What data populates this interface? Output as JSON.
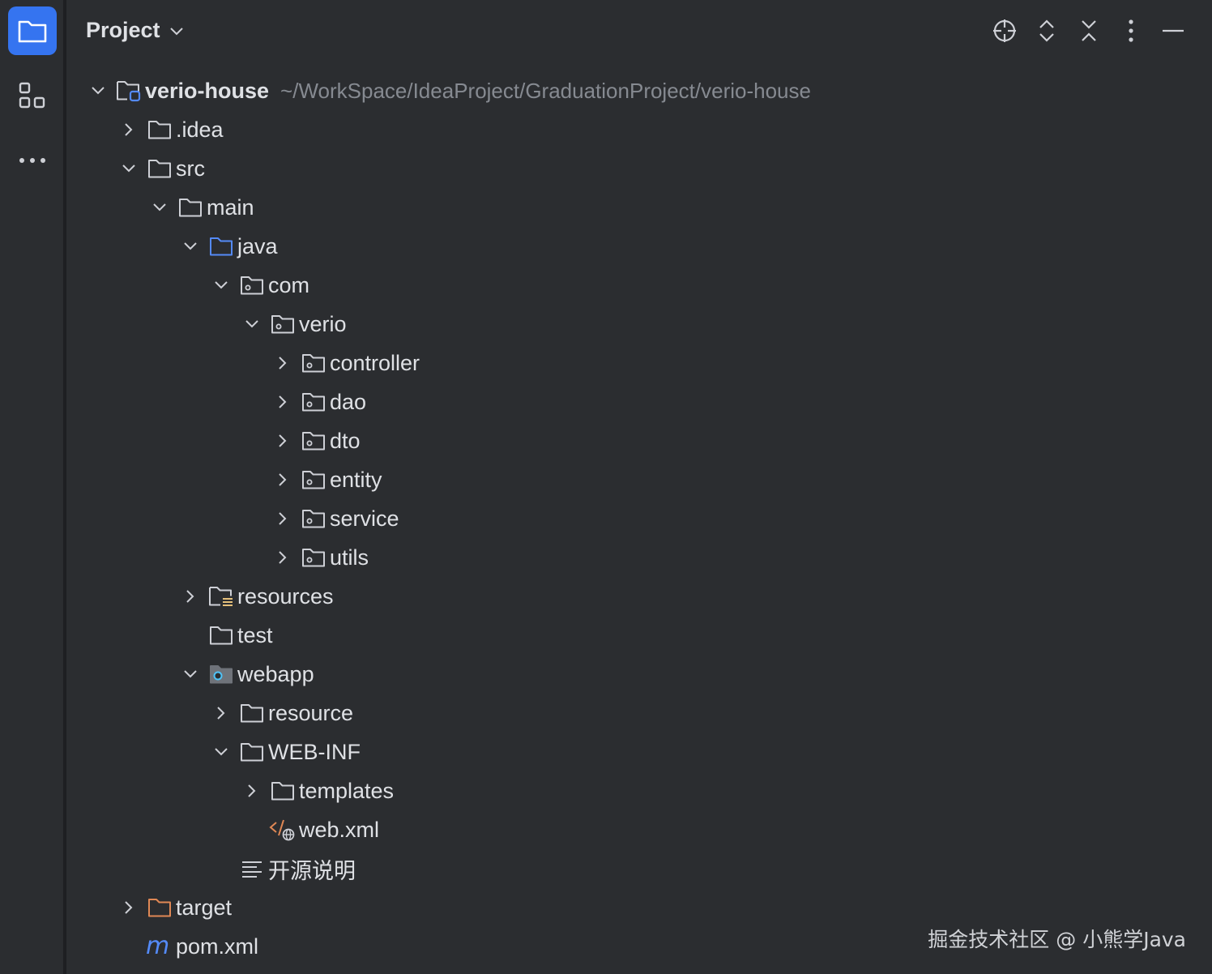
{
  "panel": {
    "title": "Project"
  },
  "tree": [
    {
      "label": "verio-house",
      "hint": "~/WorkSpace/IdeaProject/GraduationProject/verio-house",
      "depth": 0,
      "expanded": true,
      "icon": "module-folder-icon"
    },
    {
      "label": ".idea",
      "depth": 1,
      "expanded": false,
      "icon": "folder-icon"
    },
    {
      "label": "src",
      "depth": 1,
      "expanded": true,
      "icon": "folder-icon"
    },
    {
      "label": "main",
      "depth": 2,
      "expanded": true,
      "icon": "folder-icon"
    },
    {
      "label": "java",
      "depth": 3,
      "expanded": true,
      "icon": "source-root-folder-icon"
    },
    {
      "label": "com",
      "depth": 4,
      "expanded": true,
      "icon": "package-icon"
    },
    {
      "label": "verio",
      "depth": 5,
      "expanded": true,
      "icon": "package-icon"
    },
    {
      "label": "controller",
      "depth": 6,
      "expanded": false,
      "icon": "package-icon"
    },
    {
      "label": "dao",
      "depth": 6,
      "expanded": false,
      "icon": "package-icon"
    },
    {
      "label": "dto",
      "depth": 6,
      "expanded": false,
      "icon": "package-icon"
    },
    {
      "label": "entity",
      "depth": 6,
      "expanded": false,
      "icon": "package-icon"
    },
    {
      "label": "service",
      "depth": 6,
      "expanded": false,
      "icon": "package-icon"
    },
    {
      "label": "utils",
      "depth": 6,
      "expanded": false,
      "icon": "package-icon"
    },
    {
      "label": "resources",
      "depth": 3,
      "expanded": false,
      "icon": "resources-root-folder-icon"
    },
    {
      "label": "test",
      "depth": 3,
      "icon": "folder-icon"
    },
    {
      "label": "webapp",
      "depth": 3,
      "expanded": true,
      "icon": "web-folder-icon"
    },
    {
      "label": "resource",
      "depth": 4,
      "expanded": false,
      "icon": "folder-icon"
    },
    {
      "label": "WEB-INF",
      "depth": 4,
      "expanded": true,
      "icon": "folder-icon"
    },
    {
      "label": "templates",
      "depth": 5,
      "expanded": false,
      "icon": "folder-icon"
    },
    {
      "label": "web.xml",
      "depth": 5,
      "icon": "xml-file-icon"
    },
    {
      "label": "开源说明",
      "depth": 4,
      "icon": "text-file-icon"
    },
    {
      "label": "target",
      "depth": 1,
      "expanded": false,
      "icon": "excluded-folder-icon"
    },
    {
      "label": "pom.xml",
      "depth": 1,
      "icon": "maven-file-icon"
    }
  ],
  "watermark": "掘金技术社区 @ 小熊学Java",
  "colors": {
    "accent": "#3574f0",
    "folder_stroke": "#ced0d6",
    "excluded_folder": "#e08855",
    "resources_bar": "#e5c07b"
  }
}
